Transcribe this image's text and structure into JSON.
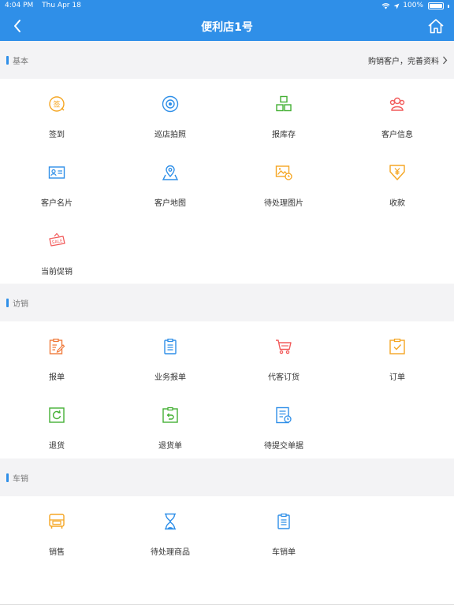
{
  "status_bar": {
    "time": "4:04 PM",
    "date": "Thu Apr 18",
    "battery": "100%"
  },
  "nav": {
    "title": "便利店1号"
  },
  "sections": {
    "basic": {
      "title": "基本",
      "link": "购销客户，完善资料",
      "items": [
        {
          "label": "签到",
          "icon": "sign-in-icon"
        },
        {
          "label": "巡店拍照",
          "icon": "camera-icon"
        },
        {
          "label": "报库存",
          "icon": "inventory-icon"
        },
        {
          "label": "客户信息",
          "icon": "customer-info-icon"
        },
        {
          "label": "客户名片",
          "icon": "business-card-icon"
        },
        {
          "label": "客户地图",
          "icon": "map-icon"
        },
        {
          "label": "待处理图片",
          "icon": "pending-image-icon"
        },
        {
          "label": "收款",
          "icon": "payment-icon"
        },
        {
          "label": "当前促销",
          "icon": "sale-icon"
        }
      ]
    },
    "visit": {
      "title": "访销",
      "items": [
        {
          "label": "报单",
          "icon": "report-order-icon"
        },
        {
          "label": "业务报单",
          "icon": "business-report-icon"
        },
        {
          "label": "代客订货",
          "icon": "cart-icon"
        },
        {
          "label": "订单",
          "icon": "order-icon"
        },
        {
          "label": "退货",
          "icon": "return-icon"
        },
        {
          "label": "退货单",
          "icon": "return-slip-icon"
        },
        {
          "label": "待提交单据",
          "icon": "pending-document-icon"
        }
      ]
    },
    "car": {
      "title": "车销",
      "items": [
        {
          "label": "销售",
          "icon": "truck-icon"
        },
        {
          "label": "待处理商品",
          "icon": "hourglass-icon"
        },
        {
          "label": "车销单",
          "icon": "car-sales-list-icon"
        }
      ]
    }
  },
  "colors": {
    "primary": "#2f8fe8",
    "orange": "#f5a623",
    "green": "#45b035",
    "red": "#f25c5c",
    "blue": "#2f8fe8"
  }
}
